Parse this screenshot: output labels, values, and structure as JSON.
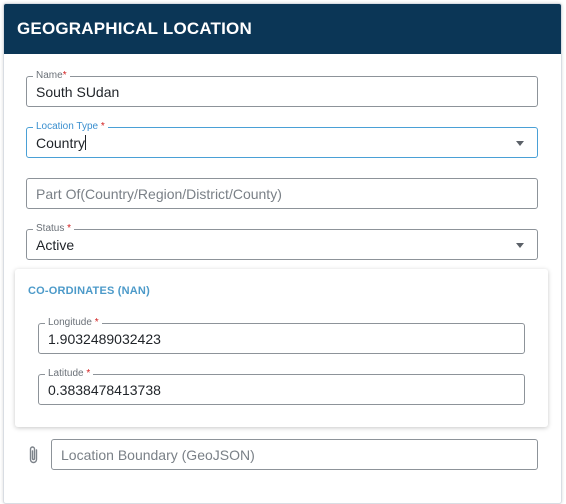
{
  "header": {
    "title": "GEOGRAPHICAL LOCATION"
  },
  "fields": {
    "name": {
      "label": "Name",
      "required": "*",
      "value": "South SUdan"
    },
    "location_type": {
      "label": "Location Type",
      "required": "*",
      "value": "Country"
    },
    "part_of": {
      "placeholder": "Part Of(Country/Region/District/County)"
    },
    "status": {
      "label": "Status",
      "required": "*",
      "value": "Active"
    }
  },
  "coordinates": {
    "title": "CO-ORDINATES (NAN)",
    "longitude": {
      "label": "Longitude",
      "required": "*",
      "value": "1.9032489032423"
    },
    "latitude": {
      "label": "Latitude",
      "required": "*",
      "value": "0.3838478413738"
    }
  },
  "boundary": {
    "placeholder": "Location Boundary (GeoJSON)",
    "icon": "paperclip-icon"
  },
  "colors": {
    "header_bg": "#0b3656",
    "accent": "#4aa0d6",
    "required": "#d11c1c"
  }
}
